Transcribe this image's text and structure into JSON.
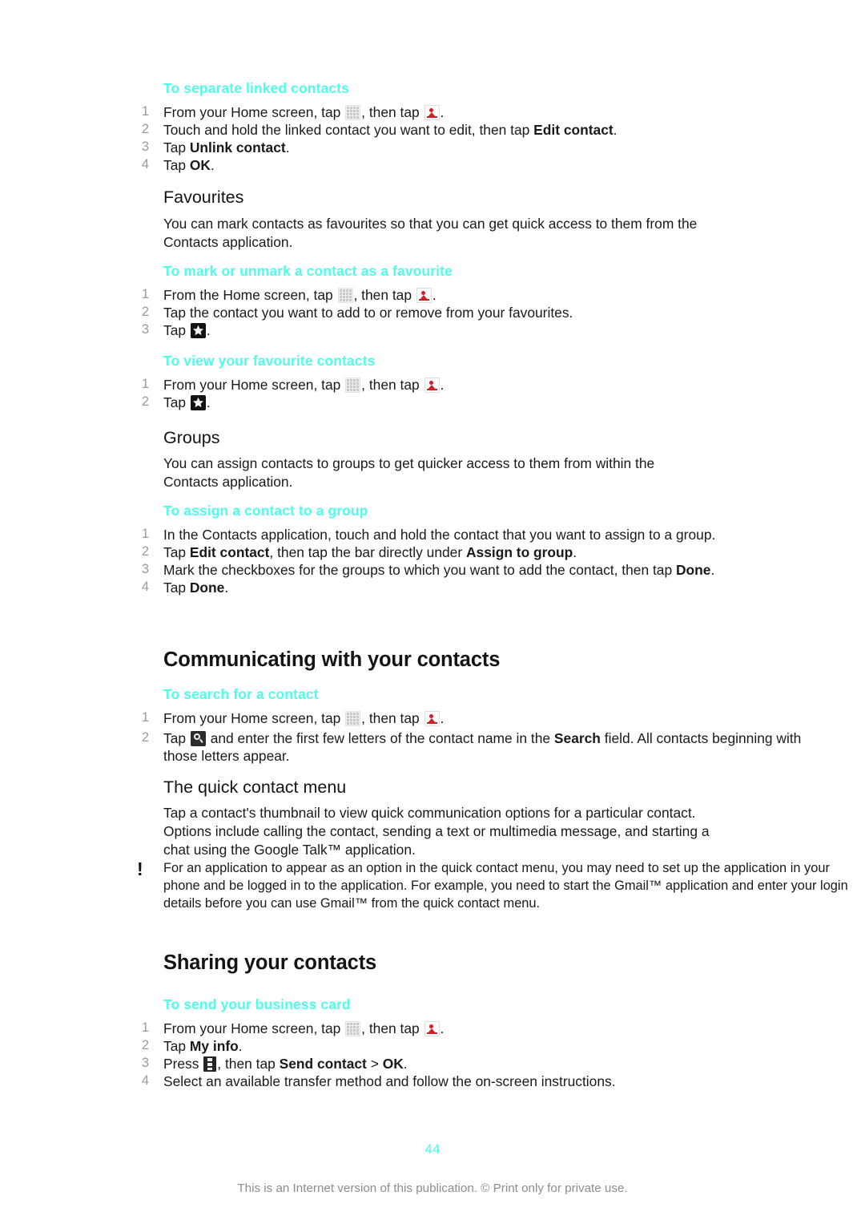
{
  "document": {
    "page_number": "44",
    "footer_note": "This is an Internet version of this publication. © Print only for private use."
  },
  "icons": {
    "grid": "app-grid-icon",
    "contact": "contacts-person-icon",
    "star": "favourite-star-icon",
    "search": "search-magnifier-icon",
    "menu": "options-menu-icon",
    "note": "exclamation-icon"
  },
  "blocks": {
    "separate_linked": {
      "heading": "To separate linked contacts",
      "steps": [
        {
          "num": "1",
          "pre": "From your Home screen, tap ",
          "icon1": "grid",
          "mid": ", then tap ",
          "icon2": "contact",
          "post": "."
        },
        {
          "num": "2",
          "pre": "Touch and hold the linked contact you want to edit, then tap ",
          "bold": "Edit contact",
          "post": "."
        },
        {
          "num": "3",
          "pre": "Tap ",
          "bold": "Unlink contact",
          "post": "."
        },
        {
          "num": "4",
          "pre": "Tap ",
          "bold": "OK",
          "post": "."
        }
      ]
    },
    "favourites": {
      "heading": "Favourites",
      "body": "You can mark contacts as favourites so that you can get quick access to them from the Contacts application."
    },
    "mark_favourite": {
      "heading": "To mark or unmark a contact as a favourite",
      "steps": [
        {
          "num": "1",
          "pre": "From the Home screen, tap ",
          "icon1": "grid",
          "mid": ", then tap ",
          "icon2": "contact",
          "post": "."
        },
        {
          "num": "2",
          "pre": "Tap the contact you want to add to or remove from your favourites."
        },
        {
          "num": "3",
          "pre": "Tap ",
          "icon1": "star",
          "post": "."
        }
      ]
    },
    "view_favourites": {
      "heading": "To view your favourite contacts",
      "steps": [
        {
          "num": "1",
          "pre": "From your Home screen, tap ",
          "icon1": "grid",
          "mid": ", then tap ",
          "icon2": "contact",
          "post": "."
        },
        {
          "num": "2",
          "pre": "Tap ",
          "icon1": "star",
          "post": "."
        }
      ]
    },
    "groups": {
      "heading": "Groups",
      "body": "You can assign contacts to groups to get quicker access to them from within the Contacts application."
    },
    "assign_group": {
      "heading": "To assign a contact to a group",
      "steps": [
        {
          "num": "1",
          "pre": "In the Contacts application, touch and hold the contact that you want to assign to a group."
        },
        {
          "num": "2",
          "pre": "Tap ",
          "bold": "Edit contact",
          "mid": ", then tap the bar directly under ",
          "bold2": "Assign to group",
          "post": "."
        },
        {
          "num": "3",
          "pre": "Mark the checkboxes for the groups to which you want to add the contact, then tap ",
          "bold": "Done",
          "post": "."
        },
        {
          "num": "4",
          "pre": "Tap ",
          "bold": "Done",
          "post": "."
        }
      ]
    },
    "communicating": {
      "heading": "Communicating with your contacts"
    },
    "search_contact": {
      "heading": "To search for a contact",
      "steps": [
        {
          "num": "1",
          "pre": "From your Home screen, tap ",
          "icon1": "grid",
          "mid": ", then tap ",
          "icon2": "contact",
          "post": "."
        },
        {
          "num": "2",
          "pre": "Tap ",
          "icon1": "search",
          "mid": " and enter the first few letters of the contact name in the ",
          "bold2": "Search",
          "post": " field. All contacts beginning with those letters appear."
        }
      ]
    },
    "quick_contact_menu": {
      "heading": "The quick contact menu",
      "body": "Tap a contact's thumbnail to view quick communication options for a particular contact. Options include calling the contact, sending a text or multimedia message, and starting a chat using the Google Talk™ application.",
      "note": "For an application to appear as an option in the quick contact menu, you may need to set up the application in your phone and be logged in to the application. For example, you need to start the Gmail™ application and enter your login details before you can use Gmail™ from the quick contact menu."
    },
    "sharing": {
      "heading": "Sharing your contacts"
    },
    "business_card": {
      "heading": "To send your business card",
      "steps": [
        {
          "num": "1",
          "pre": "From your Home screen, tap ",
          "icon1": "grid",
          "mid": ", then tap ",
          "icon2": "contact",
          "post": "."
        },
        {
          "num": "2",
          "pre": "Tap ",
          "bold": "My info",
          "post": "."
        },
        {
          "num": "3",
          "pre": "Press ",
          "icon1": "menu",
          "mid": ", then tap ",
          "bold2": "Send contact",
          "mid2": " > ",
          "bold3": "OK",
          "post": "."
        },
        {
          "num": "4",
          "pre": "Select an available transfer method and follow the on-screen instructions."
        }
      ]
    }
  },
  "colors": {
    "accent": "#4ffde9",
    "text": "#1a1a1a",
    "step_number": "#9b9b9b",
    "footer": "#8d8d8d"
  }
}
